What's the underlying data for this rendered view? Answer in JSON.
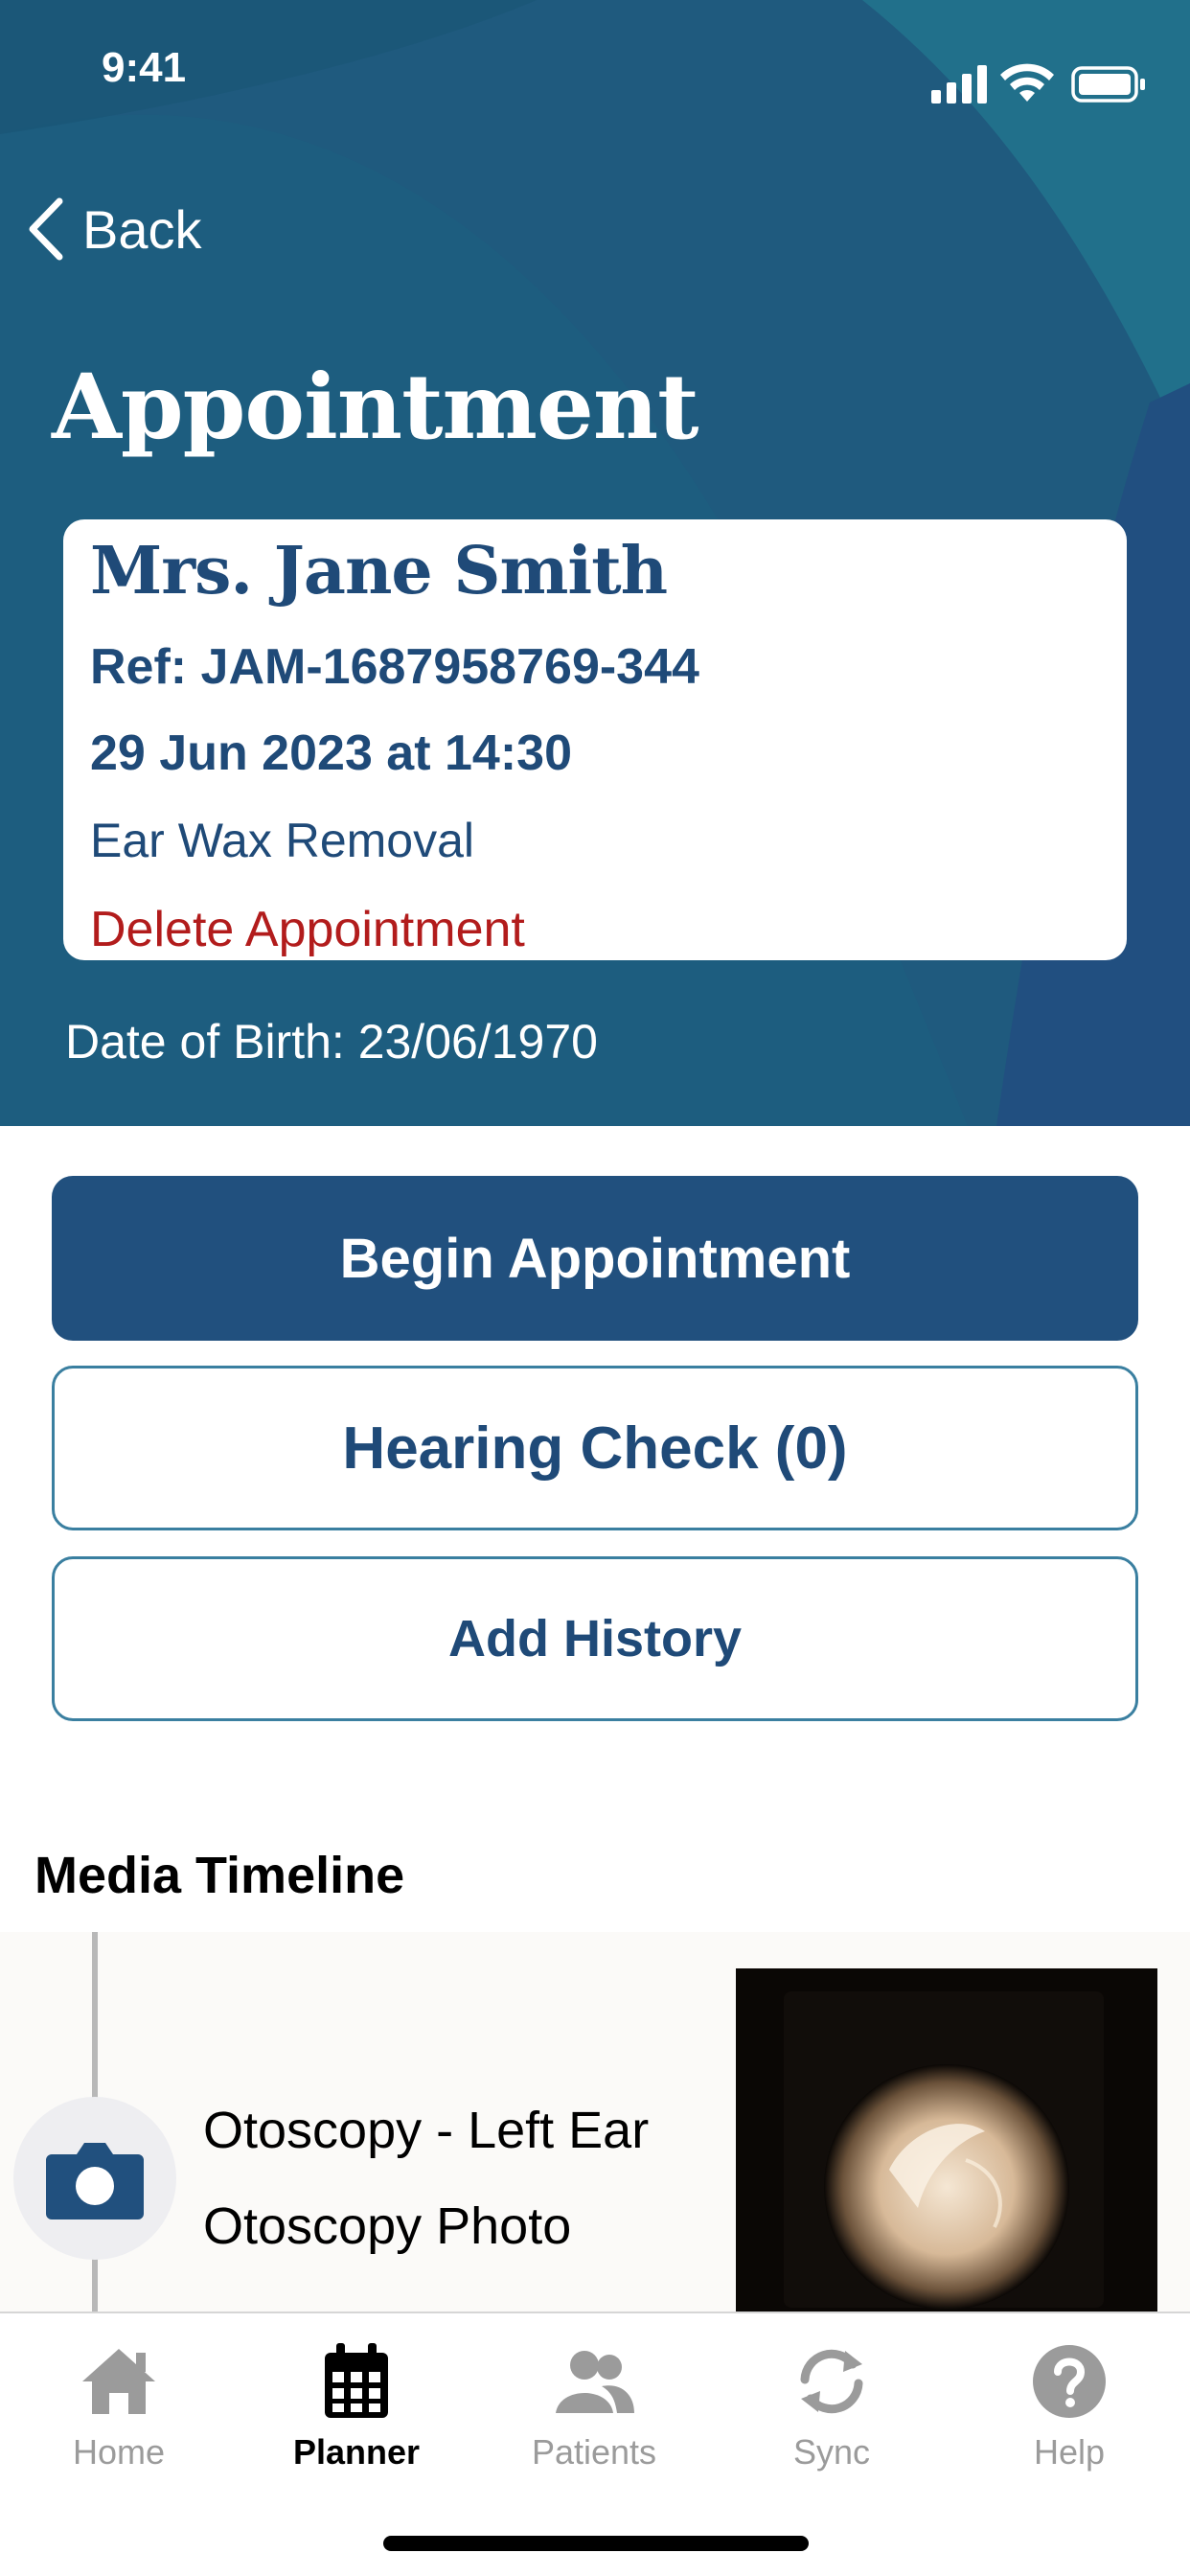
{
  "status_bar": {
    "time": "9:41"
  },
  "nav": {
    "back_label": "Back"
  },
  "page": {
    "title": "Appointment"
  },
  "appointment": {
    "patient_name": "Mrs. Jane Smith",
    "reference": "Ref: JAM-1687958769-344",
    "datetime": "29 Jun 2023 at 14:30",
    "service": "Ear Wax Removal",
    "delete_label": "Delete Appointment"
  },
  "patient": {
    "dob": "Date of Birth: 23/06/1970"
  },
  "actions": {
    "begin_label": "Begin Appointment",
    "hearing_check_label": "Hearing Check (0)",
    "add_history_label": "Add History"
  },
  "media_timeline": {
    "title": "Media Timeline",
    "items": [
      {
        "icon": "camera-icon",
        "title": "Otoscopy - Left Ear",
        "subtitle": "Otoscopy Photo"
      }
    ]
  },
  "tab_bar": {
    "active": "Planner",
    "tabs": [
      {
        "label": "Home",
        "icon": "home-icon"
      },
      {
        "label": "Planner",
        "icon": "calendar-icon"
      },
      {
        "label": "Patients",
        "icon": "people-icon"
      },
      {
        "label": "Sync",
        "icon": "sync-icon"
      },
      {
        "label": "Help",
        "icon": "help-icon"
      }
    ]
  },
  "colors": {
    "header_bg": "#1f5a7e",
    "brand_blue": "#21507e",
    "text_blue": "#1f4a78",
    "danger": "#b21c1c",
    "outline": "#3a7fa0",
    "tab_inactive": "#9b9b9b"
  }
}
